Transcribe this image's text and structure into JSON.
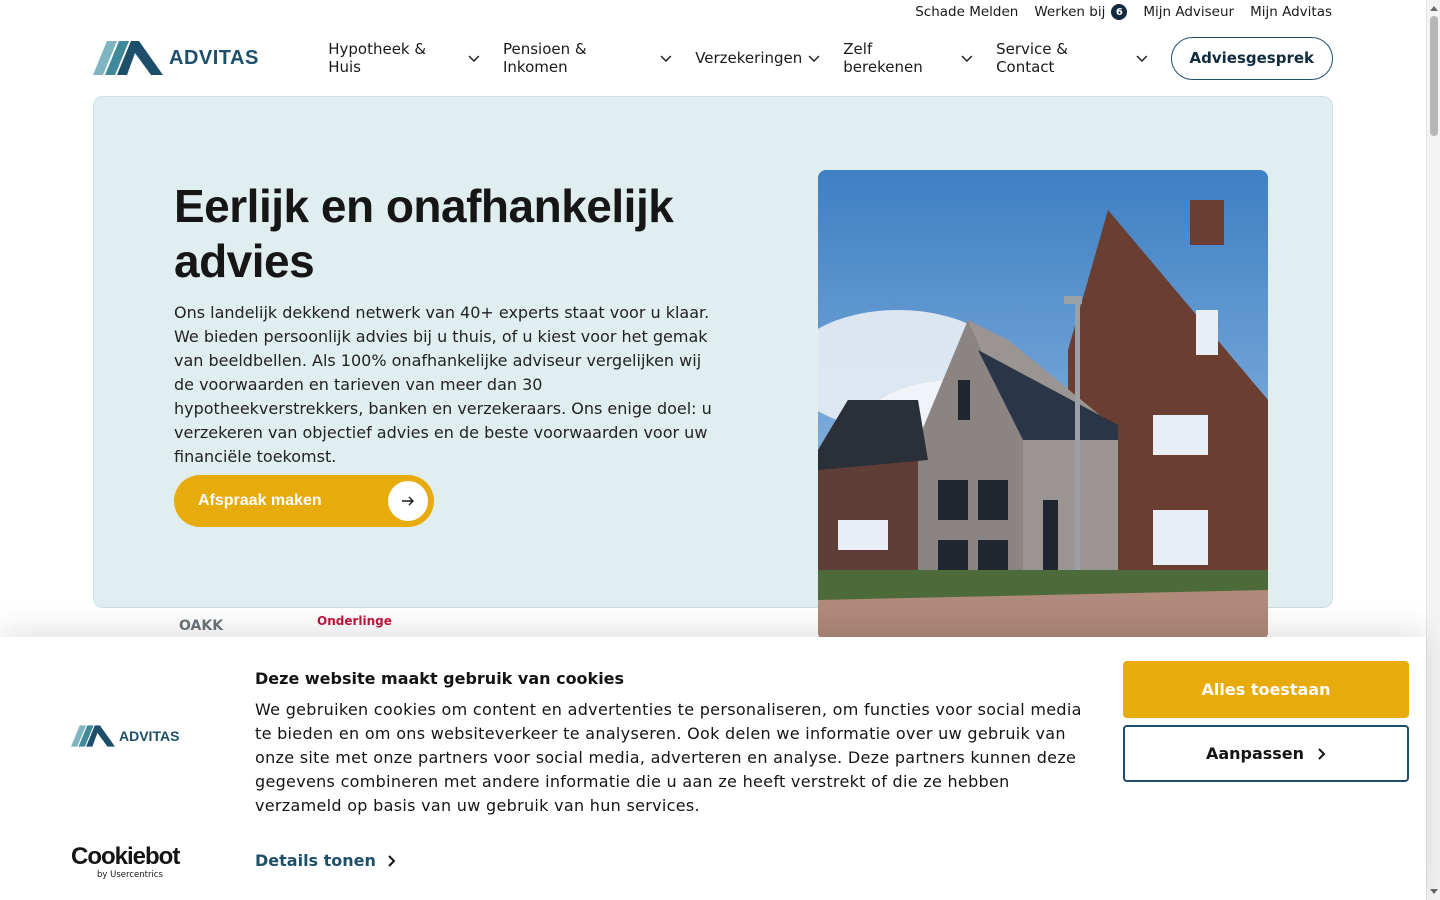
{
  "topbar": {
    "links": [
      {
        "label": "Schade Melden"
      },
      {
        "label": "Werken bij",
        "badge": "6"
      },
      {
        "label": "Mijn Adviseur"
      },
      {
        "label": "Mijn Advitas"
      }
    ]
  },
  "header": {
    "logo_text": "ADVITAS",
    "nav": [
      {
        "label": "Hypotheek & Huis",
        "icon": "chevron-down-icon"
      },
      {
        "label": "Pensioen & Inkomen",
        "icon": "chevron-down-icon"
      },
      {
        "label": "Verzekeringen",
        "icon": "chevron-down-icon"
      },
      {
        "label": "Zelf berekenen",
        "icon": "chevron-down-icon"
      },
      {
        "label": "Service & Contact",
        "icon": "chevron-down-icon"
      }
    ],
    "cta_label": "Adviesgesprek"
  },
  "hero": {
    "title": "Eerlijk en onafhankelijk advies",
    "body": "Ons landelijk dekkend netwerk van 40+ experts staat voor u klaar. We bieden persoonlijk advies bij u thuis, of u kiest voor het gemak van beeldbellen. Als 100% onafhankelijke adviseur vergelijken wij de voorwaarden en tarieven van meer dan 30 hypotheekverstrekkers, banken en verzekeraars. Ons enige doel: u verzekeren van objectief advies en de beste voorwaarden voor uw financiële toekomst.",
    "button_label": "Afspraak maken",
    "button_icon": "arrow-right-icon",
    "image": "new-build-brick-houses-photo"
  },
  "partners": [
    "OAKK",
    "Onderlinge"
  ],
  "cookie_banner": {
    "title": "Deze website maakt gebruik van cookies",
    "text": "We gebruiken cookies om content en advertenties te personaliseren, om functies voor social media te bieden en om ons websiteverkeer te analyseren. Ook delen we informatie over uw gebruik van onze site met onze partners voor social media, adverteren en analyse. Deze partners kunnen deze gegevens combineren met andere informatie die u aan ze heeft verstrekt of die ze hebben verzameld op basis van uw gebruik van hun services.",
    "details_label": "Details tonen",
    "allow_label": "Alles toestaan",
    "customize_label": "Aanpassen",
    "logo_text": "ADVITAS",
    "cookiebot_name": "Cookiebot",
    "cookiebot_by": "by Usercentrics"
  },
  "colors": {
    "brand_dark": "#0f2b3d",
    "brand_teal": "#1d4f6b",
    "accent_yellow": "#e8ab0c",
    "hero_bg": "#e1eef0"
  }
}
